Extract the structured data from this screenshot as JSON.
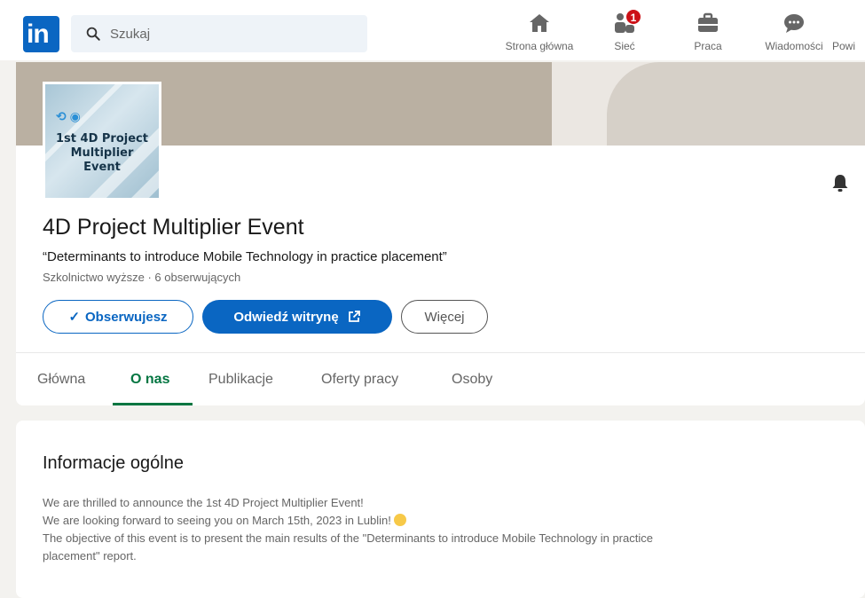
{
  "nav": {
    "logo_text": "in",
    "search_placeholder": "Szukaj",
    "items": [
      {
        "label": "Strona główna",
        "icon": "home-icon"
      },
      {
        "label": "Sieć",
        "icon": "network-icon",
        "badge": "1"
      },
      {
        "label": "Praca",
        "icon": "briefcase-icon"
      },
      {
        "label": "Wiadomości",
        "icon": "messaging-icon"
      },
      {
        "label": "Powi"
      }
    ]
  },
  "company": {
    "logo_lines": [
      "1st 4D Project",
      "Multiplier",
      "Event"
    ],
    "name": "4D Project Multiplier Event",
    "tagline": "“Determinants to introduce Mobile Technology in practice placement”",
    "meta": "Szkolnictwo wyższe · 6 obserwujących",
    "buttons": {
      "follow": "Obserwujesz",
      "follow_icon": "✓",
      "visit": "Odwiedź witrynę",
      "more": "Więcej"
    },
    "tabs": [
      "Główna",
      "O nas",
      "Publikacje",
      "Oferty pracy",
      "Osoby"
    ],
    "active_tab": "O nas"
  },
  "about": {
    "title": "Informacje ogólne",
    "lines": [
      "We are thrilled to announce the 1st 4D Project Multiplier Event!",
      "We are looking forward to seeing you on March 15th, 2023 in Lublin!",
      "The objective of this event is to present the main results of the \"Determinants to introduce Mobile Technology in practice",
      "placement\" report."
    ]
  },
  "colors": {
    "brand": "#0a66c2",
    "active_tab": "#057642",
    "badge": "#cc1016",
    "background": "#f3f2ef"
  }
}
